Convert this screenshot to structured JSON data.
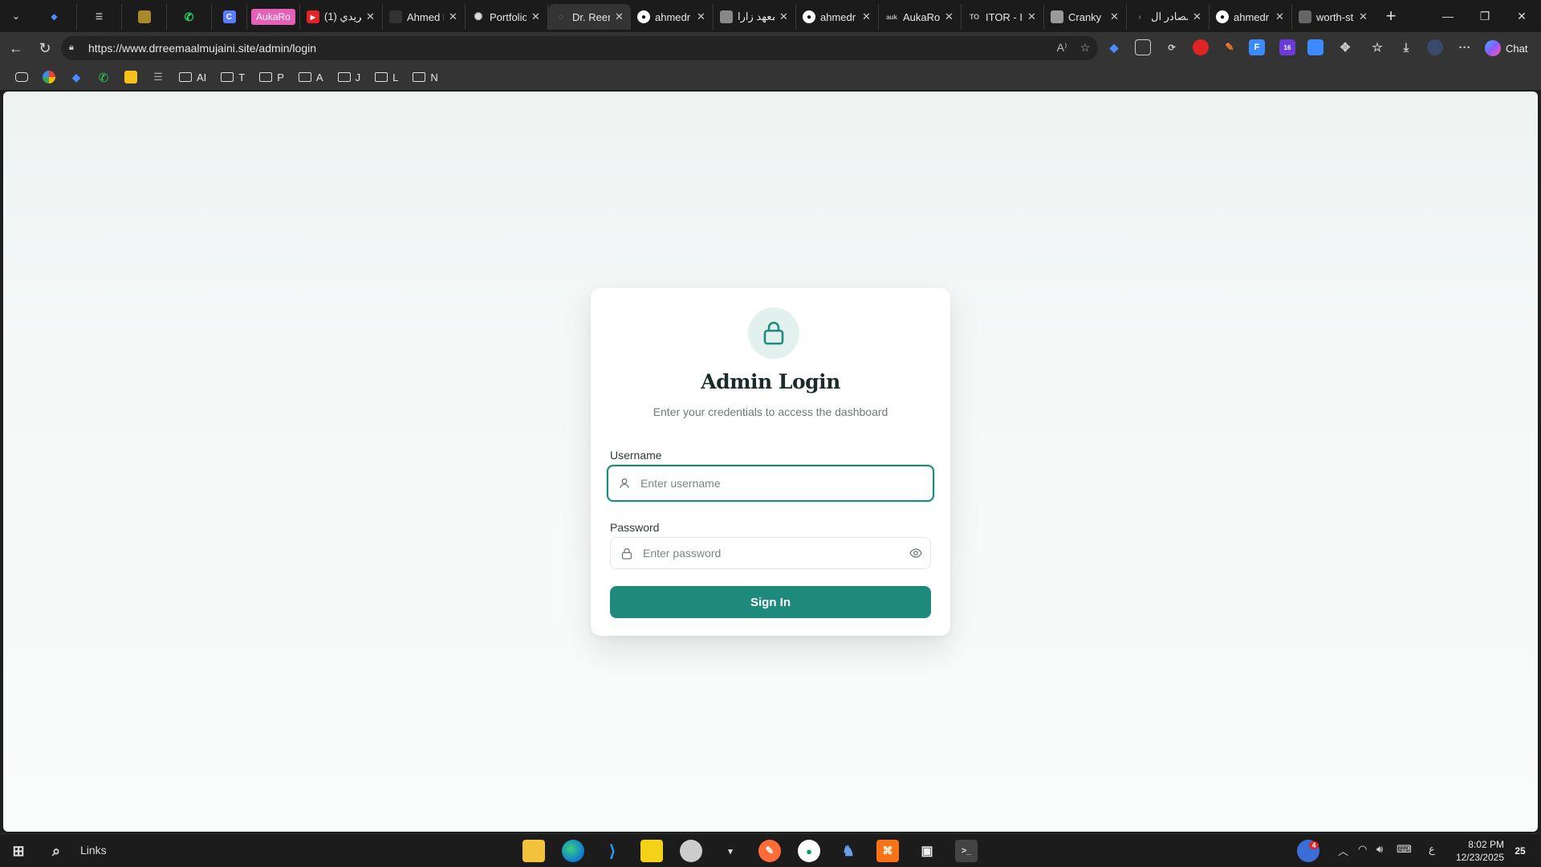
{
  "browser": {
    "tabs": [
      {
        "title": "",
        "pinned": true
      },
      {
        "title": "",
        "pinned": true
      },
      {
        "title": "",
        "pinned": true
      },
      {
        "title": "",
        "pinned": true
      },
      {
        "title": "",
        "pinned": true,
        "badge": "C"
      },
      {
        "title": "AukaRo",
        "pinned": true,
        "badge_style": "pink"
      },
      {
        "title": "(1) فريدي",
        "pinned": false
      },
      {
        "title": "Ahmed R",
        "pinned": false
      },
      {
        "title": "Portfolio",
        "pinned": false
      },
      {
        "title": "Dr. Reem",
        "pinned": false,
        "active": true
      },
      {
        "title": "ahmedr",
        "pinned": false
      },
      {
        "title": "معهد زارا",
        "pinned": false
      },
      {
        "title": "ahmedr",
        "pinned": false
      },
      {
        "title": "AukaRo",
        "pinned": false
      },
      {
        "title": "ITOR - Id",
        "pinned": false
      },
      {
        "title": "Cranky",
        "pinned": false
      },
      {
        "title": "مصادر ال",
        "pinned": false
      },
      {
        "title": "ahmedr",
        "pinned": false
      },
      {
        "title": "worth-st",
        "pinned": false
      }
    ],
    "url": "https://www.drreemaalmujaini.site/admin/login",
    "chat_label": "Chat",
    "bookmarks": [
      {
        "label": "",
        "icon": "google-icon"
      },
      {
        "label": "",
        "icon": "gemini-icon"
      },
      {
        "label": "",
        "icon": "whatsapp-icon"
      },
      {
        "label": "",
        "icon": "keep-icon"
      },
      {
        "label": "",
        "icon": "list-icon"
      },
      {
        "label": "AI",
        "icon": "folder-icon"
      },
      {
        "label": "T",
        "icon": "folder-icon"
      },
      {
        "label": "P",
        "icon": "folder-icon"
      },
      {
        "label": "A",
        "icon": "folder-icon"
      },
      {
        "label": "J",
        "icon": "folder-icon"
      },
      {
        "label": "L",
        "icon": "folder-icon"
      },
      {
        "label": "N",
        "icon": "folder-icon"
      }
    ]
  },
  "login": {
    "title": "Admin Login",
    "subtitle": "Enter your credentials to access the dashboard",
    "username_label": "Username",
    "username_placeholder": "Enter username",
    "password_label": "Password",
    "password_placeholder": "Enter password",
    "submit_label": "Sign In",
    "accent_color": "#1d8a7c"
  },
  "taskbar": {
    "search_label": "Links",
    "time": "8:02 PM",
    "date": "12/23/2025",
    "notification_count": "25",
    "weather_badge": "4",
    "lang": "ع"
  }
}
